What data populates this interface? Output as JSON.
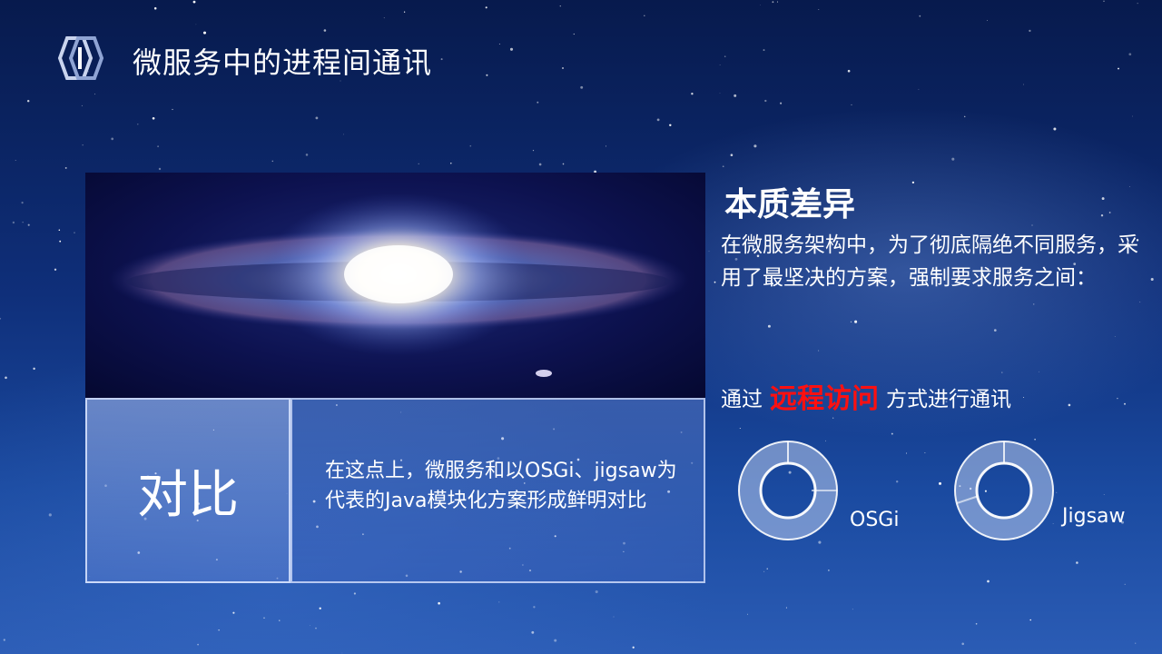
{
  "slide": {
    "title": "微服务中的进程间通讯",
    "left_panel": {
      "label": "对比",
      "text": "在这点上，微服务和以OSGi、jigsaw为代表的Java模块化方案形成鲜明对比"
    },
    "right": {
      "heading": "本质差异",
      "body": "在微服务架构中，为了彻底隔绝不同服务，采用了最坚决的方案，强制要求服务之间：",
      "comm_prefix": "通过",
      "comm_highlight": "远程访问",
      "comm_suffix": "方式进行通讯"
    },
    "rings": [
      {
        "label": "OSGi"
      },
      {
        "label": "Jigsaw"
      }
    ]
  },
  "colors": {
    "highlight": "#ff1010",
    "text": "#ffffff",
    "background": "#0f2f7a"
  },
  "icons": {
    "title_logo": "hexagon-cube-icon",
    "rings": "ring-icon"
  }
}
